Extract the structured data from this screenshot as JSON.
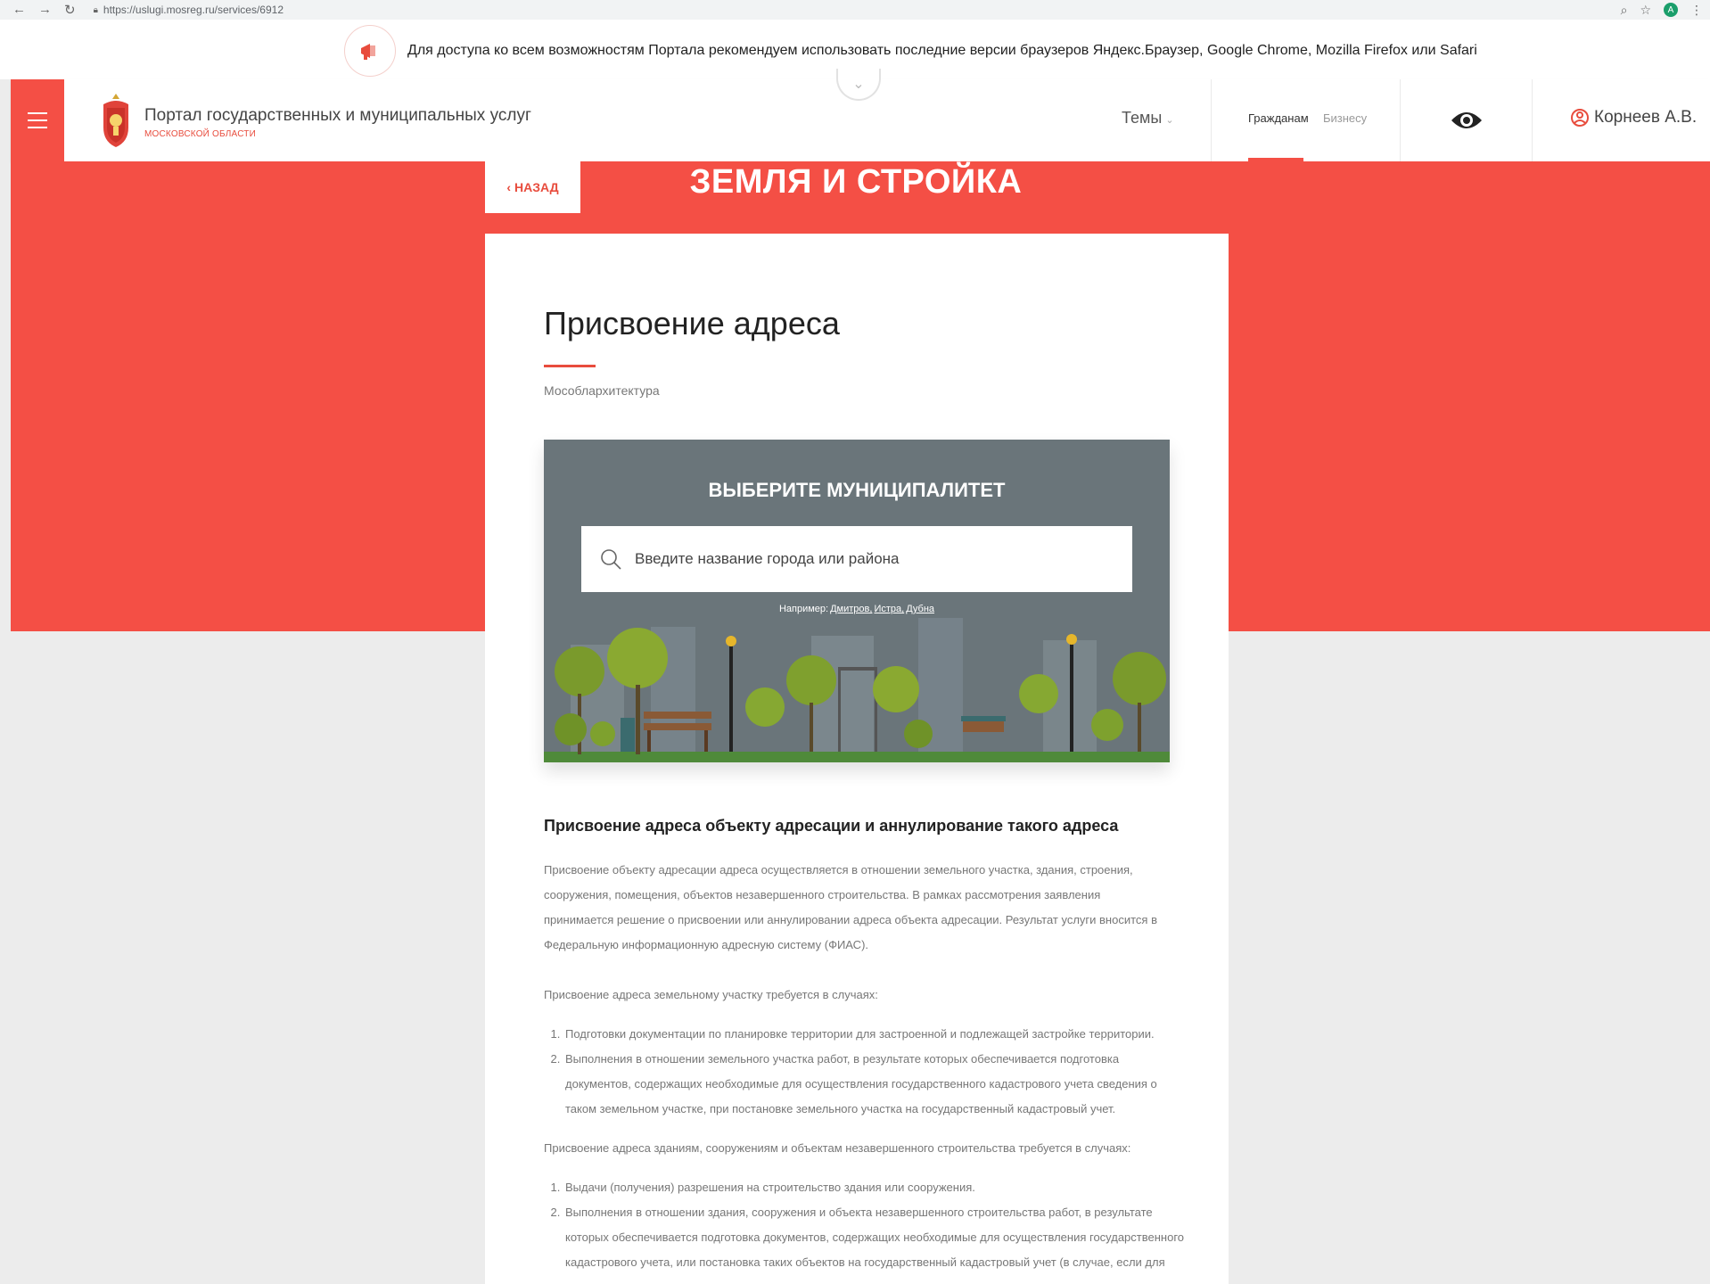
{
  "browser": {
    "url": "https://uslugi.mosreg.ru/services/6912",
    "profile_initial": "A"
  },
  "notice": {
    "text": "Для доступа ко всем возможностям Портала рекомендуем использовать последние версии браузеров Яндекс.Браузер, Google Chrome, Mozilla Firefox или Safari"
  },
  "header": {
    "portal_title": "Портал государственных и муниципальных услуг",
    "portal_subtitle": "МОСКОВСКОЙ ОБЛАСТИ",
    "themes_label": "Темы",
    "tabs": [
      {
        "label": "Гражданам",
        "active": true
      },
      {
        "label": "Бизнесу",
        "active": false
      }
    ],
    "user_name": "Корнеев А.В."
  },
  "section": {
    "back_label": "НАЗАД",
    "title": "ЗЕМЛЯ И СТРОЙКА"
  },
  "service": {
    "title": "Присвоение адреса",
    "organization": "Мособлархитектура"
  },
  "municipality": {
    "title": "ВЫБЕРИТЕ МУНИЦИПАЛИТЕТ",
    "search_placeholder": "Введите название города или района",
    "examples_label": "Например:",
    "examples": [
      "Дмитров,",
      "Истра,",
      "Дубна"
    ]
  },
  "description": {
    "heading": "Присвоение адреса объекту адресации и аннулирование такого адреса",
    "intro": "Присвоение объекту адресации адреса осуществляется в отношении земельного участка, здания, строения, сооружения, помещения, объектов незавершенного строительства. В рамках рассмотрения заявления принимается решение о присвоении или аннулировании адреса объекта адресации. Результат услуги вносится в Федеральную информационную адресную систему (ФИАС).",
    "land_heading": "Присвоение адреса земельному участку требуется в случаях:",
    "land_items": [
      "Подготовки документации по планировке территории для застроенной и подлежащей застройке территории.",
      "Выполнения в отношении земельного участка работ, в результате которых обеспечивается подготовка документов, содержащих необходимые для осуществления государственного кадастрового учета сведения о таком земельном участке, при постановке земельного участка на государственный кадастровый учет."
    ],
    "building_heading": "Присвоение адреса зданиям, сооружениям и объектам незавершенного строительства требуется в случаях:",
    "building_items": [
      "Выдачи (получения) разрешения на строительство здания или сооружения.",
      "Выполнения в отношении здания, сооружения и объекта незавершенного строительства работ, в результате которых обеспечивается подготовка документов, содержащих необходимые для осуществления государственного кадастрового учета, или постановка таких объектов на государственный кадастровый учет (в случае, если для"
    ]
  },
  "colors": {
    "accent": "#f44f45",
    "accent_dark": "#e84c3d",
    "page_bg": "#ececec"
  },
  "icons": [
    "back-arrow-icon",
    "forward-arrow-icon",
    "reload-icon",
    "lock-icon",
    "zoom-icon",
    "star-icon",
    "megaphone-icon",
    "menu-icon",
    "crest-icon",
    "chevron-down-icon",
    "eye-icon",
    "user-icon",
    "search-icon"
  ]
}
